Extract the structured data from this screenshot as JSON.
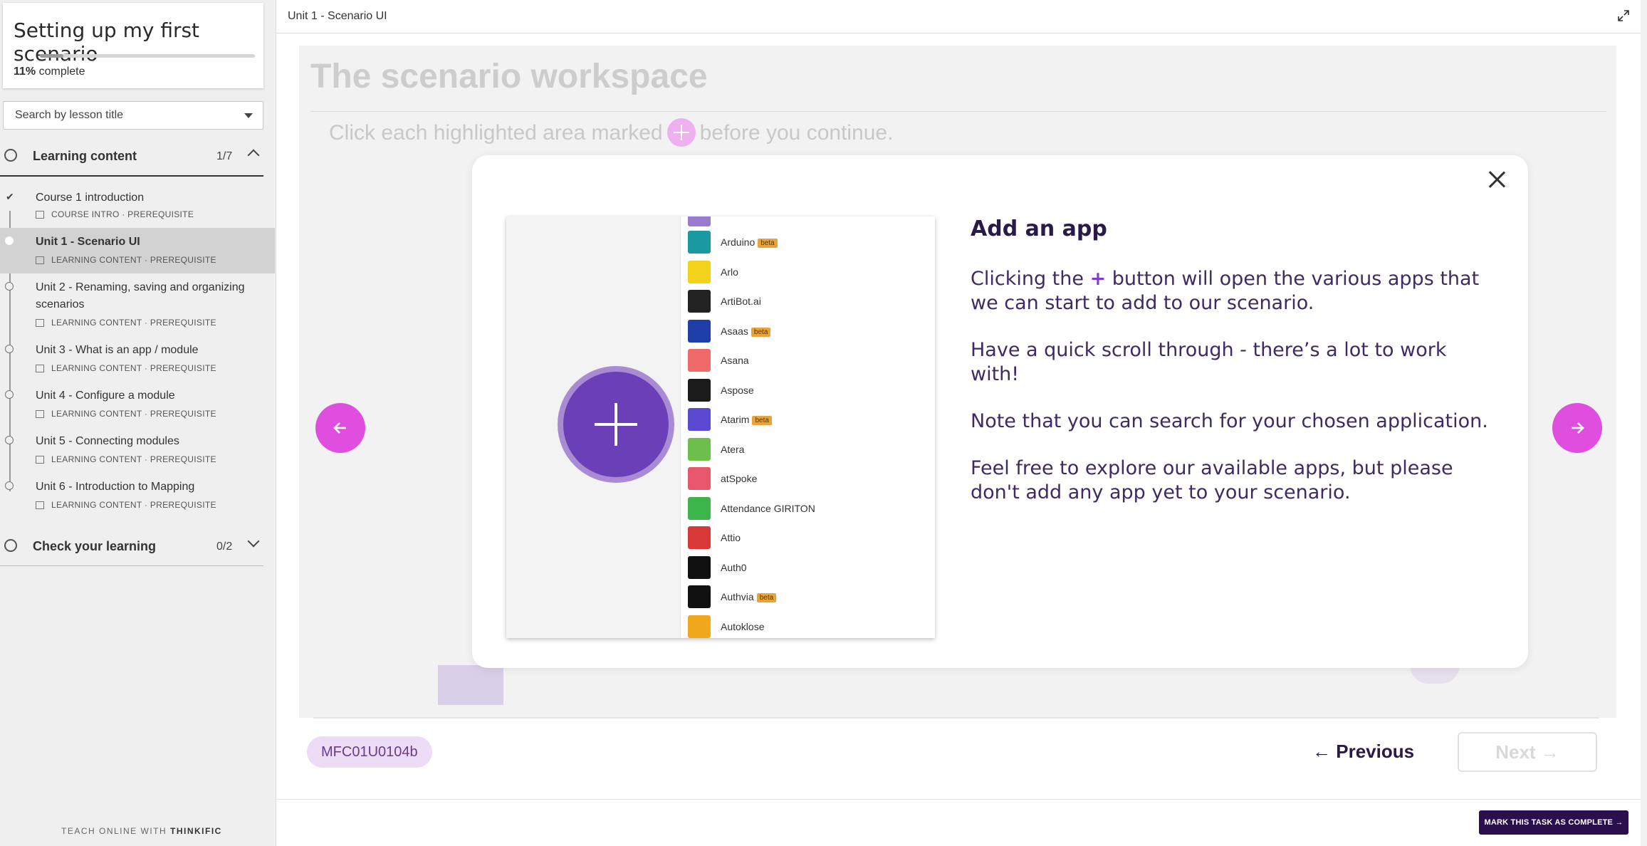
{
  "sidebar": {
    "course_title": "Setting up my first scenario",
    "progress_percent": "11%",
    "progress_suffix": "complete",
    "progress_fraction": 0.11,
    "search_placeholder": "Search by lesson title",
    "chapters": [
      {
        "title": "Learning content",
        "count": "1/7",
        "expanded": true
      },
      {
        "title": "Check your learning",
        "count": "0/2",
        "expanded": false
      }
    ],
    "lessons": [
      {
        "title": "Course 1 introduction",
        "meta": "COURSE INTRO · PREREQUISITE",
        "completed": true
      },
      {
        "title": "Unit 1 - Scenario UI",
        "meta": "LEARNING CONTENT · PREREQUISITE",
        "active": true
      },
      {
        "title": "Unit 2 - Renaming, saving and organizing scenarios",
        "meta": "LEARNING CONTENT · PREREQUISITE"
      },
      {
        "title": "Unit 3 - What is an app / module",
        "meta": "LEARNING CONTENT · PREREQUISITE"
      },
      {
        "title": "Unit 4 - Configure a module",
        "meta": "LEARNING CONTENT · PREREQUISITE"
      },
      {
        "title": "Unit 5 - Connecting modules",
        "meta": "LEARNING CONTENT · PREREQUISITE"
      },
      {
        "title": "Unit 6 - Introduction to Mapping",
        "meta": "LEARNING CONTENT · PREREQUISITE"
      }
    ],
    "footer_prefix": "TEACH ONLINE WITH",
    "footer_brand": "THINKIFIC"
  },
  "header": {
    "breadcrumb": "Unit 1 - Scenario UI"
  },
  "stage": {
    "bg_title": "The scenario workspace",
    "bg_instruction_before": "Click each highlighted area marked",
    "bg_instruction_after": "before you continue."
  },
  "modal": {
    "heading": "Add an app",
    "p1_before": "Clicking the",
    "p1_plus": "+",
    "p1_after": "button will open the various apps that we can start to add to our scenario.",
    "p2": "Have a quick scroll through - there’s a lot to work with!",
    "p3": "Note that you can search for your chosen application.",
    "p4": "Feel free to explore our available apps, but please don't add any app yet to your scenario.",
    "beta_label": "beta",
    "apps": [
      {
        "name": "Arduino",
        "beta": true,
        "color": "#1a9aa0"
      },
      {
        "name": "Arlo",
        "beta": false,
        "color": "#f2d21a"
      },
      {
        "name": "ArtiBot.ai",
        "beta": false,
        "color": "#222222"
      },
      {
        "name": "Asaas",
        "beta": true,
        "color": "#1e3fa8"
      },
      {
        "name": "Asana",
        "beta": false,
        "color": "#f06a6a"
      },
      {
        "name": "Aspose",
        "beta": false,
        "color": "#1b1b1b"
      },
      {
        "name": "Atarim",
        "beta": true,
        "color": "#5b4ad1"
      },
      {
        "name": "Atera",
        "beta": false,
        "color": "#6cbf4a"
      },
      {
        "name": "atSpoke",
        "beta": false,
        "color": "#e8566b"
      },
      {
        "name": "Attendance GIRITON",
        "beta": false,
        "color": "#3bb54a"
      },
      {
        "name": "Attio",
        "beta": false,
        "color": "#d93838"
      },
      {
        "name": "Auth0",
        "beta": false,
        "color": "#111111"
      },
      {
        "name": "Authvia",
        "beta": true,
        "color": "#111111"
      },
      {
        "name": "Autoklose",
        "beta": false,
        "color": "#f2a81d"
      }
    ]
  },
  "footer": {
    "code": "MFC01U0104b",
    "previous": "Previous",
    "next": "Next",
    "complete": "MARK THIS TASK AS COMPLETE"
  },
  "colors": {
    "accent": "#e04ee0",
    "primary_dark": "#2b0f4d",
    "badge_bg": "#ecdcf5"
  }
}
